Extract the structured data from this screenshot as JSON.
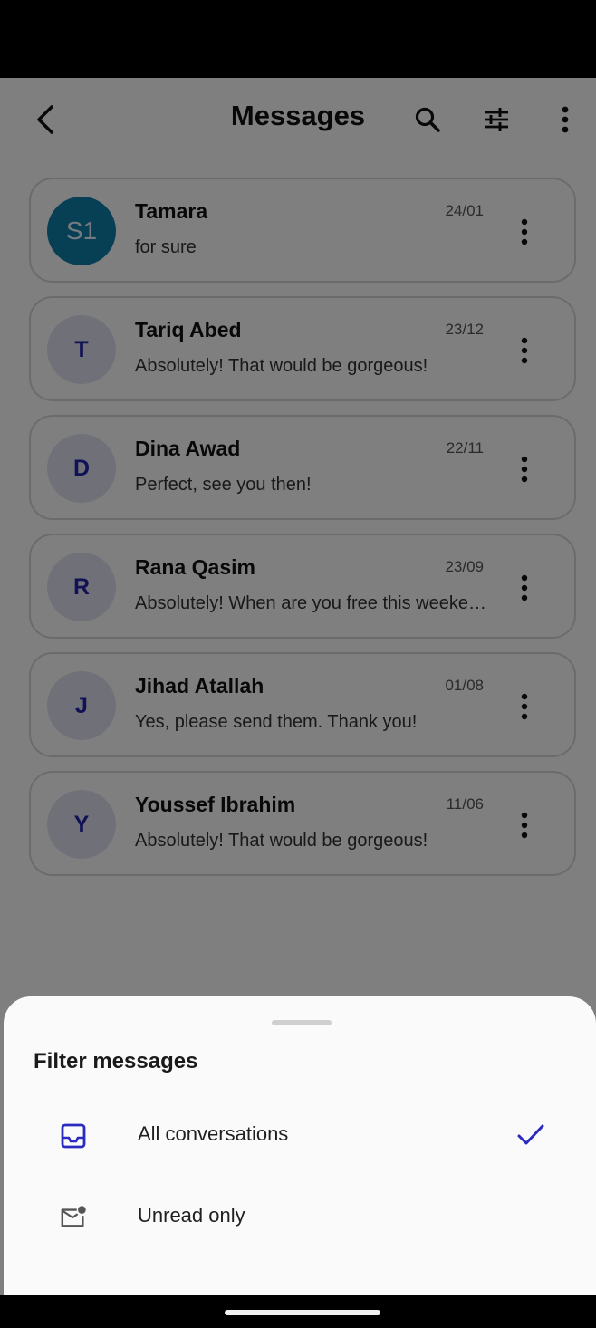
{
  "header": {
    "title": "Messages",
    "back_icon": "back-arrow-icon",
    "search_icon": "search-icon",
    "filter_icon": "tune-icon",
    "more_icon": "more-vertical-icon"
  },
  "conversations": [
    {
      "avatar": "S1",
      "name": "Tamara",
      "date": "24/01",
      "preview": "for sure"
    },
    {
      "avatar": "T",
      "name": "Tariq Abed",
      "date": "23/12",
      "preview": "Absolutely! That would be gorgeous!"
    },
    {
      "avatar": "D",
      "name": "Dina Awad",
      "date": "22/11",
      "preview": "Perfect, see you then!"
    },
    {
      "avatar": "R",
      "name": "Rana Qasim",
      "date": "23/09",
      "preview": "Absolutely! When are you free this weekend?"
    },
    {
      "avatar": "J",
      "name": "Jihad Atallah",
      "date": "01/08",
      "preview": "Yes, please send them. Thank you!"
    },
    {
      "avatar": "Y",
      "name": "Youssef Ibrahim",
      "date": "11/06",
      "preview": "Absolutely! That would be gorgeous!"
    }
  ],
  "filter_sheet": {
    "title": "Filter messages",
    "options": [
      {
        "label": "All conversations",
        "icon": "inbox-icon",
        "selected": true
      },
      {
        "label": "Unread only",
        "icon": "mark-email-unread-icon",
        "selected": false
      }
    ]
  },
  "colors": {
    "accent": "#2a2abf",
    "teal_avatar": "#0e7faa",
    "avatar_bg": "#e1e1f3"
  }
}
